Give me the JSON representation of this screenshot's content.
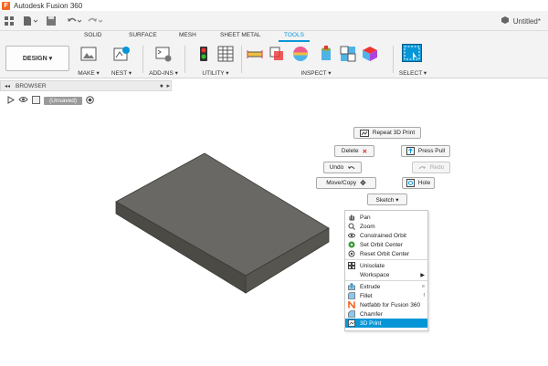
{
  "app": {
    "title": "Autodesk Fusion 360",
    "logo_letter": "F"
  },
  "document": {
    "title": "Untitled*"
  },
  "workspace": {
    "label": "DESIGN ▾"
  },
  "tabs": [
    {
      "label": "SOLID"
    },
    {
      "label": "SURFACE"
    },
    {
      "label": "MESH"
    },
    {
      "label": "SHEET METAL"
    },
    {
      "label": "TOOLS"
    }
  ],
  "active_tab": "TOOLS",
  "accent_color": "#0696d7",
  "groups": {
    "make": "MAKE ▾",
    "nest": "NEST ▾",
    "addins": "ADD-INS ▾",
    "utility": "UTILITY ▾",
    "inspect": "INSPECT ▾",
    "select": "SELECT ▾"
  },
  "browser": {
    "label": "BROWSER",
    "root_label": "(Unsaved)"
  },
  "marking_menu": {
    "repeat": "Repeat 3D Print",
    "delete": "Delete",
    "press_pull": "Press Pull",
    "undo": "Undo",
    "redo": "Redo",
    "move_copy": "Move/Copy",
    "hole": "Hole",
    "sketch": "Sketch ▾"
  },
  "context_menu": {
    "items": [
      {
        "label": "Pan",
        "icon": "hand-icon"
      },
      {
        "label": "Zoom",
        "icon": "zoom-icon"
      },
      {
        "label": "Constrained Orbit",
        "icon": "orbit-icon"
      },
      {
        "label": "Set Orbit Center",
        "icon": "orbit-center-icon"
      },
      {
        "label": "Reset Orbit Center",
        "icon": "reset-orbit-icon"
      },
      {
        "label": "Unisolate",
        "icon": "unisolate-icon"
      },
      {
        "label": "Workspace",
        "icon": "",
        "submenu": "▶"
      },
      {
        "label": "Extrude",
        "icon": "extrude-icon",
        "shortcut": "e"
      },
      {
        "label": "Fillet",
        "icon": "fillet-icon",
        "shortcut": "f"
      },
      {
        "label": "Netfabb for Fusion 360",
        "icon": "netfabb-icon"
      },
      {
        "label": "Chamfer",
        "icon": "chamfer-icon"
      },
      {
        "label": "3D Print",
        "icon": "print3d-icon"
      }
    ],
    "highlighted": "3D Print"
  }
}
